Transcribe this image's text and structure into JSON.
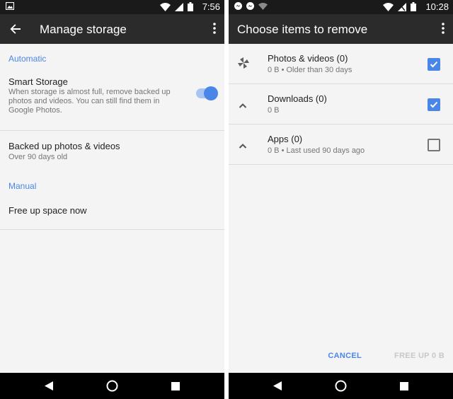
{
  "left": {
    "status_time": "7:56",
    "title": "Manage storage",
    "section_automatic": "Automatic",
    "smart_storage": {
      "title": "Smart Storage",
      "description": "When storage is almost full, remove backed up photos and videos. You can still find them in Google Photos.",
      "enabled": true
    },
    "backed_up": {
      "title": "Backed up photos & videos",
      "subtitle": "Over 90 days old"
    },
    "section_manual": "Manual",
    "free_up": "Free up space now"
  },
  "right": {
    "status_time": "10:28",
    "title": "Choose items to remove",
    "items": [
      {
        "title": "Photos & videos (0)",
        "subtitle": "0 B • Older than 30 days",
        "checked": true,
        "icon": "pinwheel-icon"
      },
      {
        "title": "Downloads (0)",
        "subtitle": "0 B",
        "checked": true,
        "icon": "chevron-up-icon"
      },
      {
        "title": "Apps (0)",
        "subtitle": "0 B • Last used 90 days ago",
        "checked": false,
        "icon": "chevron-up-icon"
      }
    ],
    "cancel_label": "CANCEL",
    "free_up_label": "FREE UP 0 B"
  },
  "colors": {
    "accent": "#4a86e8",
    "appbar": "#2b2b2b",
    "statusbar": "#1a1a1a",
    "background": "#f4f4f4"
  }
}
